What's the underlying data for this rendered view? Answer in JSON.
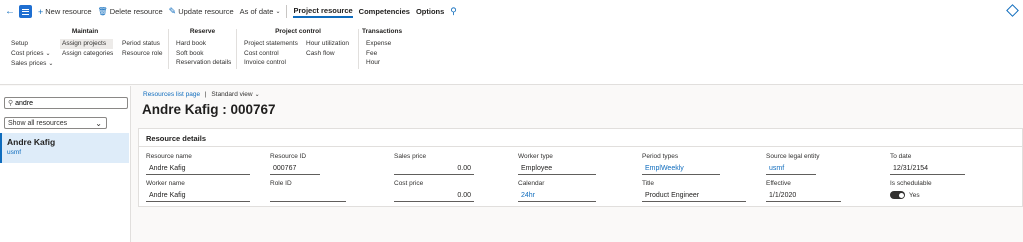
{
  "actionbar": {
    "new_resource": "New resource",
    "delete_resource": "Delete resource",
    "update_resource": "Update resource",
    "as_of_date": "As of date",
    "project_resource": "Project resource",
    "competencies": "Competencies",
    "options": "Options"
  },
  "ribbon": {
    "maintain": {
      "title": "Maintain",
      "col1": [
        "Setup",
        "Cost prices",
        "Sales prices"
      ],
      "col2": [
        "Assign projects",
        "Assign categories"
      ],
      "col3": [
        "Period status",
        "Resource role"
      ]
    },
    "reserve": {
      "title": "Reserve",
      "items": [
        "Hard book",
        "Soft book",
        "Reservation details"
      ]
    },
    "project_control": {
      "title": "Project control",
      "col1": [
        "Project statements",
        "Cost control",
        "Invoice control"
      ],
      "col2": [
        "Hour utilization",
        "Cash flow"
      ]
    },
    "transactions": {
      "title": "Transactions",
      "items": [
        "Expense",
        "Fee",
        "Hour"
      ]
    }
  },
  "leftpanel": {
    "filter_value": "andre",
    "view_select": "Show all resources",
    "record": {
      "name": "Andre Kafig",
      "legal_entity": "usmf"
    }
  },
  "page": {
    "breadcrumb_link": "Resources list page",
    "breadcrumb_sep": "|",
    "view": "Standard view",
    "title": "Andre Kafig : 000767"
  },
  "details": {
    "title": "Resource details",
    "fields": {
      "resource_name": {
        "label": "Resource name",
        "value": "Andre Kafig"
      },
      "resource_id": {
        "label": "Resource ID",
        "value": "000767"
      },
      "sales_price": {
        "label": "Sales price",
        "value": "0.00"
      },
      "worker_type": {
        "label": "Worker type",
        "value": "Employee"
      },
      "period_types": {
        "label": "Period types",
        "value": "EmplWeekly"
      },
      "source_legal_entity": {
        "label": "Source legal entity",
        "value": "usmf"
      },
      "to_date": {
        "label": "To date",
        "value": "12/31/2154"
      },
      "worker_name": {
        "label": "Worker name",
        "value": "Andre Kafig"
      },
      "role_id": {
        "label": "Role ID",
        "value": ""
      },
      "cost_price": {
        "label": "Cost price",
        "value": "0.00"
      },
      "calendar": {
        "label": "Calendar",
        "value": "24hr"
      },
      "title_field": {
        "label": "Title",
        "value": "Product Engineer"
      },
      "effective": {
        "label": "Effective",
        "value": "1/1/2020"
      },
      "is_schedulable": {
        "label": "Is schedulable",
        "value": "Yes"
      }
    }
  },
  "colors": {
    "accent": "#0f6cbd",
    "selected_bg": "#deecf9"
  }
}
